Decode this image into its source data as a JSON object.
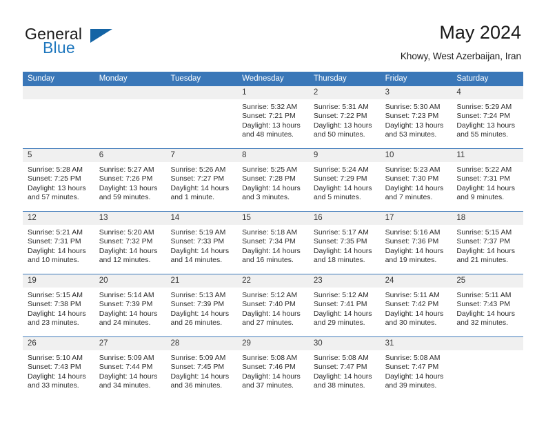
{
  "brand": {
    "word_one": "General",
    "word_two": "Blue",
    "logo_icon": "triangle-logo-icon"
  },
  "header": {
    "title": "May 2024",
    "subtitle": "Khowy, West Azerbaijan, Iran"
  },
  "colors": {
    "header_blue": "#3a77b8",
    "brand_blue": "#1d76bd",
    "logo_blue": "#1464a5",
    "day_band_gray": "#f0f0f0"
  },
  "calendar": {
    "day_names": [
      "Sunday",
      "Monday",
      "Tuesday",
      "Wednesday",
      "Thursday",
      "Friday",
      "Saturday"
    ],
    "weeks": [
      [
        {
          "day": "",
          "empty": true
        },
        {
          "day": "",
          "empty": true
        },
        {
          "day": "",
          "empty": true
        },
        {
          "day": "1",
          "sunrise": "Sunrise: 5:32 AM",
          "sunset": "Sunset: 7:21 PM",
          "daylight": "Daylight: 13 hours and 48 minutes."
        },
        {
          "day": "2",
          "sunrise": "Sunrise: 5:31 AM",
          "sunset": "Sunset: 7:22 PM",
          "daylight": "Daylight: 13 hours and 50 minutes."
        },
        {
          "day": "3",
          "sunrise": "Sunrise: 5:30 AM",
          "sunset": "Sunset: 7:23 PM",
          "daylight": "Daylight: 13 hours and 53 minutes."
        },
        {
          "day": "4",
          "sunrise": "Sunrise: 5:29 AM",
          "sunset": "Sunset: 7:24 PM",
          "daylight": "Daylight: 13 hours and 55 minutes."
        }
      ],
      [
        {
          "day": "5",
          "sunrise": "Sunrise: 5:28 AM",
          "sunset": "Sunset: 7:25 PM",
          "daylight": "Daylight: 13 hours and 57 minutes."
        },
        {
          "day": "6",
          "sunrise": "Sunrise: 5:27 AM",
          "sunset": "Sunset: 7:26 PM",
          "daylight": "Daylight: 13 hours and 59 minutes."
        },
        {
          "day": "7",
          "sunrise": "Sunrise: 5:26 AM",
          "sunset": "Sunset: 7:27 PM",
          "daylight": "Daylight: 14 hours and 1 minute."
        },
        {
          "day": "8",
          "sunrise": "Sunrise: 5:25 AM",
          "sunset": "Sunset: 7:28 PM",
          "daylight": "Daylight: 14 hours and 3 minutes."
        },
        {
          "day": "9",
          "sunrise": "Sunrise: 5:24 AM",
          "sunset": "Sunset: 7:29 PM",
          "daylight": "Daylight: 14 hours and 5 minutes."
        },
        {
          "day": "10",
          "sunrise": "Sunrise: 5:23 AM",
          "sunset": "Sunset: 7:30 PM",
          "daylight": "Daylight: 14 hours and 7 minutes."
        },
        {
          "day": "11",
          "sunrise": "Sunrise: 5:22 AM",
          "sunset": "Sunset: 7:31 PM",
          "daylight": "Daylight: 14 hours and 9 minutes."
        }
      ],
      [
        {
          "day": "12",
          "sunrise": "Sunrise: 5:21 AM",
          "sunset": "Sunset: 7:31 PM",
          "daylight": "Daylight: 14 hours and 10 minutes."
        },
        {
          "day": "13",
          "sunrise": "Sunrise: 5:20 AM",
          "sunset": "Sunset: 7:32 PM",
          "daylight": "Daylight: 14 hours and 12 minutes."
        },
        {
          "day": "14",
          "sunrise": "Sunrise: 5:19 AM",
          "sunset": "Sunset: 7:33 PM",
          "daylight": "Daylight: 14 hours and 14 minutes."
        },
        {
          "day": "15",
          "sunrise": "Sunrise: 5:18 AM",
          "sunset": "Sunset: 7:34 PM",
          "daylight": "Daylight: 14 hours and 16 minutes."
        },
        {
          "day": "16",
          "sunrise": "Sunrise: 5:17 AM",
          "sunset": "Sunset: 7:35 PM",
          "daylight": "Daylight: 14 hours and 18 minutes."
        },
        {
          "day": "17",
          "sunrise": "Sunrise: 5:16 AM",
          "sunset": "Sunset: 7:36 PM",
          "daylight": "Daylight: 14 hours and 19 minutes."
        },
        {
          "day": "18",
          "sunrise": "Sunrise: 5:15 AM",
          "sunset": "Sunset: 7:37 PM",
          "daylight": "Daylight: 14 hours and 21 minutes."
        }
      ],
      [
        {
          "day": "19",
          "sunrise": "Sunrise: 5:15 AM",
          "sunset": "Sunset: 7:38 PM",
          "daylight": "Daylight: 14 hours and 23 minutes."
        },
        {
          "day": "20",
          "sunrise": "Sunrise: 5:14 AM",
          "sunset": "Sunset: 7:39 PM",
          "daylight": "Daylight: 14 hours and 24 minutes."
        },
        {
          "day": "21",
          "sunrise": "Sunrise: 5:13 AM",
          "sunset": "Sunset: 7:39 PM",
          "daylight": "Daylight: 14 hours and 26 minutes."
        },
        {
          "day": "22",
          "sunrise": "Sunrise: 5:12 AM",
          "sunset": "Sunset: 7:40 PM",
          "daylight": "Daylight: 14 hours and 27 minutes."
        },
        {
          "day": "23",
          "sunrise": "Sunrise: 5:12 AM",
          "sunset": "Sunset: 7:41 PM",
          "daylight": "Daylight: 14 hours and 29 minutes."
        },
        {
          "day": "24",
          "sunrise": "Sunrise: 5:11 AM",
          "sunset": "Sunset: 7:42 PM",
          "daylight": "Daylight: 14 hours and 30 minutes."
        },
        {
          "day": "25",
          "sunrise": "Sunrise: 5:11 AM",
          "sunset": "Sunset: 7:43 PM",
          "daylight": "Daylight: 14 hours and 32 minutes."
        }
      ],
      [
        {
          "day": "26",
          "sunrise": "Sunrise: 5:10 AM",
          "sunset": "Sunset: 7:43 PM",
          "daylight": "Daylight: 14 hours and 33 minutes."
        },
        {
          "day": "27",
          "sunrise": "Sunrise: 5:09 AM",
          "sunset": "Sunset: 7:44 PM",
          "daylight": "Daylight: 14 hours and 34 minutes."
        },
        {
          "day": "28",
          "sunrise": "Sunrise: 5:09 AM",
          "sunset": "Sunset: 7:45 PM",
          "daylight": "Daylight: 14 hours and 36 minutes."
        },
        {
          "day": "29",
          "sunrise": "Sunrise: 5:08 AM",
          "sunset": "Sunset: 7:46 PM",
          "daylight": "Daylight: 14 hours and 37 minutes."
        },
        {
          "day": "30",
          "sunrise": "Sunrise: 5:08 AM",
          "sunset": "Sunset: 7:47 PM",
          "daylight": "Daylight: 14 hours and 38 minutes."
        },
        {
          "day": "31",
          "sunrise": "Sunrise: 5:08 AM",
          "sunset": "Sunset: 7:47 PM",
          "daylight": "Daylight: 14 hours and 39 minutes."
        },
        {
          "day": "",
          "empty": true
        }
      ]
    ]
  }
}
